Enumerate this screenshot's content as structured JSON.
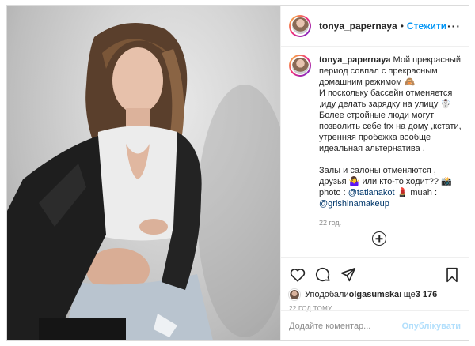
{
  "post": {
    "username": "tonya_papernaya",
    "separator": "•",
    "follow_label": "Стежити",
    "more_icon": "more-horizontal-icon"
  },
  "caption": {
    "username": "tonya_papernaya",
    "text": "Мой прекрасный период совпал с прекрасным домашним режимом 🙈\nИ поскольку бассейн отменяется ,иду делать зарядку на улицу ☃️\nБолее стройные люди могут позволить себе trx на дому ,кстати, утренняя пробежка вообще идеальная альтернатива .\n\nЗалы и салоны отменяются , друзья 🤷‍♀️ или кто-то ходит?? 📸 photo :",
    "mention1": "@tatianakot",
    "after_mention1": " 💄 muah :",
    "mention2": "@grishinamakeup",
    "time": "22 год."
  },
  "actions": {
    "like_icon": "heart-icon",
    "comment_icon": "comment-icon",
    "share_icon": "share-icon",
    "save_icon": "bookmark-icon"
  },
  "likes": {
    "prefix": "Уподобали ",
    "user": "olgasumska",
    "middle": " і ще ",
    "count": "3 176"
  },
  "timestamp": "22 ГОД ТОМУ",
  "comment_box": {
    "placeholder": "Додайте коментар...",
    "post_label": "Опублікувати"
  }
}
